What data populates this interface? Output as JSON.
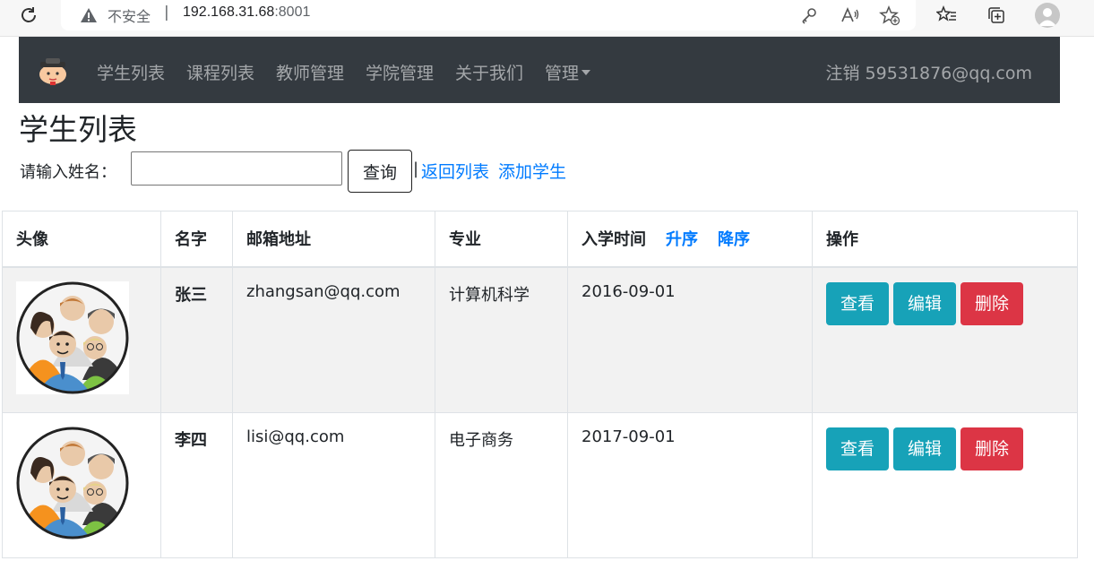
{
  "browser": {
    "insecure_label": "不安全",
    "separator": "|",
    "url_host": "192.168.31.68",
    "url_port": ":8001"
  },
  "navbar": {
    "items": [
      "学生列表",
      "课程列表",
      "教师管理",
      "学院管理",
      "关于我们",
      "管理"
    ],
    "logout": "注销",
    "user": "59531876@qq.com"
  },
  "page": {
    "title": "学生列表",
    "search_label": "请输入姓名：",
    "search_value": "",
    "search_button": "查询",
    "pipe": "|",
    "back_link": "返回列表",
    "add_link": "添加学生"
  },
  "table": {
    "headers": [
      "头像",
      "名字",
      "邮箱地址",
      "专业",
      "入学时间",
      "操作"
    ],
    "sort_asc": "升序",
    "sort_desc": "降序",
    "rows": [
      {
        "name": "张三",
        "email": "zhangsan@qq.com",
        "major": "计算机科学",
        "date": "2016-09-01"
      },
      {
        "name": "李四",
        "email": "lisi@qq.com",
        "major": "电子商务",
        "date": "2017-09-01"
      }
    ],
    "actions": {
      "view": "查看",
      "edit": "编辑",
      "delete": "删除"
    }
  },
  "colors": {
    "navbar": "#343a40",
    "link": "#007bff",
    "info": "#17a2b8",
    "danger": "#dc3545"
  }
}
